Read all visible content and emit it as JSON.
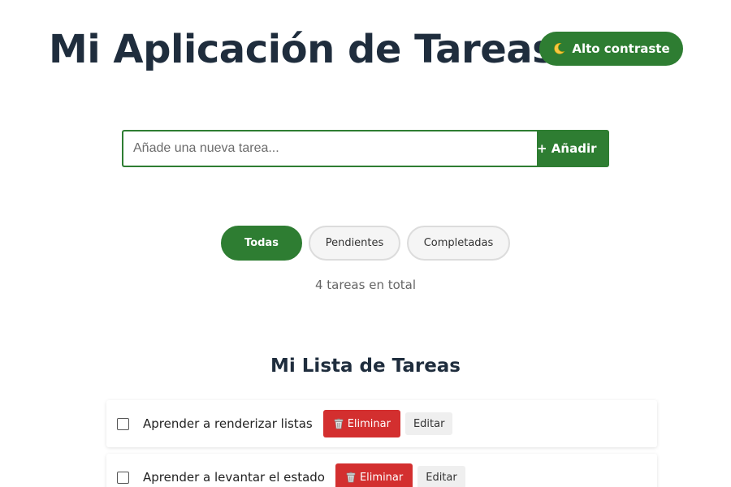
{
  "header": {
    "title": "Mi Aplicación de Tareas",
    "contrast_label": "Alto contraste",
    "contrast_icon": "moon-icon"
  },
  "add_form": {
    "placeholder": "Añade una nueva tarea...",
    "value": "",
    "add_label": "+ Añadir"
  },
  "filters": {
    "items": [
      {
        "label": "Todas",
        "active": true
      },
      {
        "label": "Pendientes",
        "active": false
      },
      {
        "label": "Completadas",
        "active": false
      }
    ]
  },
  "count_text": "4 tareas en total",
  "list": {
    "title": "Mi Lista de Tareas",
    "delete_label": "Eliminar",
    "edit_label": "Editar",
    "tasks": [
      {
        "text": "Aprender a renderizar listas",
        "completed": false
      },
      {
        "text": "Aprender a levantar el estado",
        "completed": false
      }
    ]
  },
  "colors": {
    "accent": "#2e7d32",
    "danger": "#d32f2f",
    "title": "#1f2d3d"
  }
}
